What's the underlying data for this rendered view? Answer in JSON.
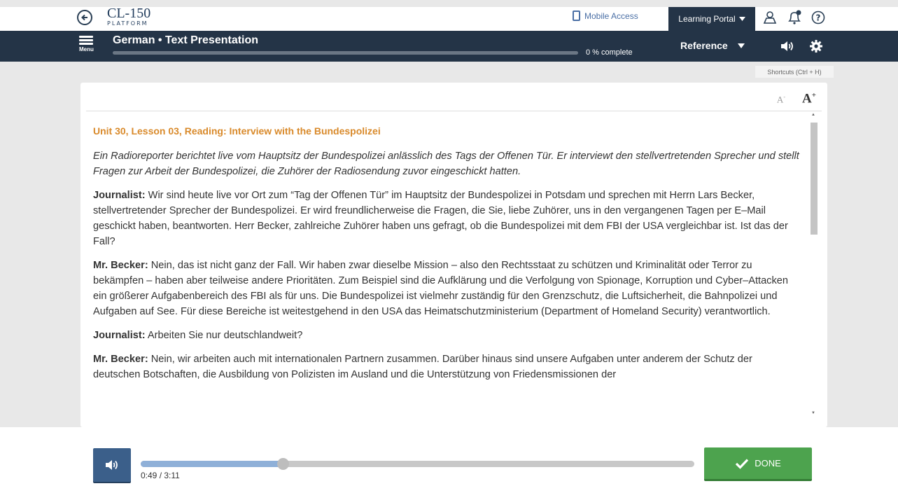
{
  "header": {
    "logo_main": "CL-150",
    "logo_sub": "PLATFORM",
    "mobile_access": "Mobile Access",
    "learning_portal": "Learning Portal"
  },
  "nav": {
    "menu_label": "Menu",
    "title": "German • Text Presentation",
    "progress_text": "0 % complete",
    "progress_percent": 0,
    "reference_label": "Reference"
  },
  "shortcuts": "Shortcuts (Ctrl + H)",
  "font_controls": {
    "decrease": "A",
    "decrease_sup": "-",
    "increase": "A",
    "increase_sup": "+"
  },
  "reading": {
    "title": "Unit 30, Lesson 03, Reading: Interview with the Bundespolizei",
    "intro": "Ein Radioreporter berichtet live vom Hauptsitz der Bundespolizei anlässlich des Tags der Offenen Tür. Er interviewt den stellvertretenden Sprecher und stellt Fragen zur Arbeit der Bundespolizei, die Zuhörer der Radiosendung zuvor eingeschickt hatten.",
    "paragraphs": [
      {
        "speaker": "Journalist:",
        "text": " Wir sind heute live vor Ort zum “Tag der Offenen Tür” im Hauptsitz der Bundespolizei in Potsdam und sprechen mit Herrn Lars Becker, stellvertretender Sprecher der Bundespolizei. Er wird freundlicherweise die Fragen, die Sie, liebe Zuhörer, uns in den vergangenen Tagen per E–Mail geschickt haben, beantworten. Herr Becker, zahlreiche Zuhörer haben uns gefragt, ob die Bundespolizei mit dem FBI der USA vergleichbar ist. Ist das der Fall?"
      },
      {
        "speaker": "Mr. Becker:",
        "text": " Nein, das ist nicht ganz der Fall. Wir haben zwar dieselbe Mission – also den Rechtsstaat zu schützen und Kriminalität oder Terror zu bekämpfen – haben aber teilweise andere Prioritäten. Zum Beispiel sind die Aufklärung und die Verfolgung von Spionage, Korruption und Cyber–Attacken ein größerer Aufgabenbereich des FBI als für uns. Die Bundespolizei ist vielmehr zuständig für den Grenzschutz, die Luftsicherheit, die Bahnpolizei und Aufgaben auf See. Für diese Bereiche ist weitestgehend in den USA das Heimatschutzministerium (Department of Homeland Security) verantwortlich."
      },
      {
        "speaker": "Journalist:",
        "text": " Arbeiten Sie nur deutschlandweit?"
      },
      {
        "speaker": "Mr. Becker:",
        "text": " Nein, wir arbeiten auch mit internationalen Partnern zusammen. Darüber hinaus sind unsere Aufgaben unter anderem der Schutz der deutschen Botschaften, die Ausbildung von Polizisten im Ausland und die Unterstützung von Friedensmissionen der"
      }
    ]
  },
  "player": {
    "time": "0:49 / 3:11",
    "played_fraction": 0.2565,
    "done_label": "DONE"
  },
  "colors": {
    "navy": "#243447",
    "accent_orange": "#d98a2b",
    "done_green": "#4da34e",
    "audio_blue": "#3b5f8a"
  },
  "icons": [
    "back-arrow-icon",
    "phone-icon",
    "caret-down-icon",
    "user-icon",
    "bell-icon",
    "help-icon",
    "menu-icon",
    "speaker-icon",
    "gear-icon",
    "checkmark-icon"
  ]
}
